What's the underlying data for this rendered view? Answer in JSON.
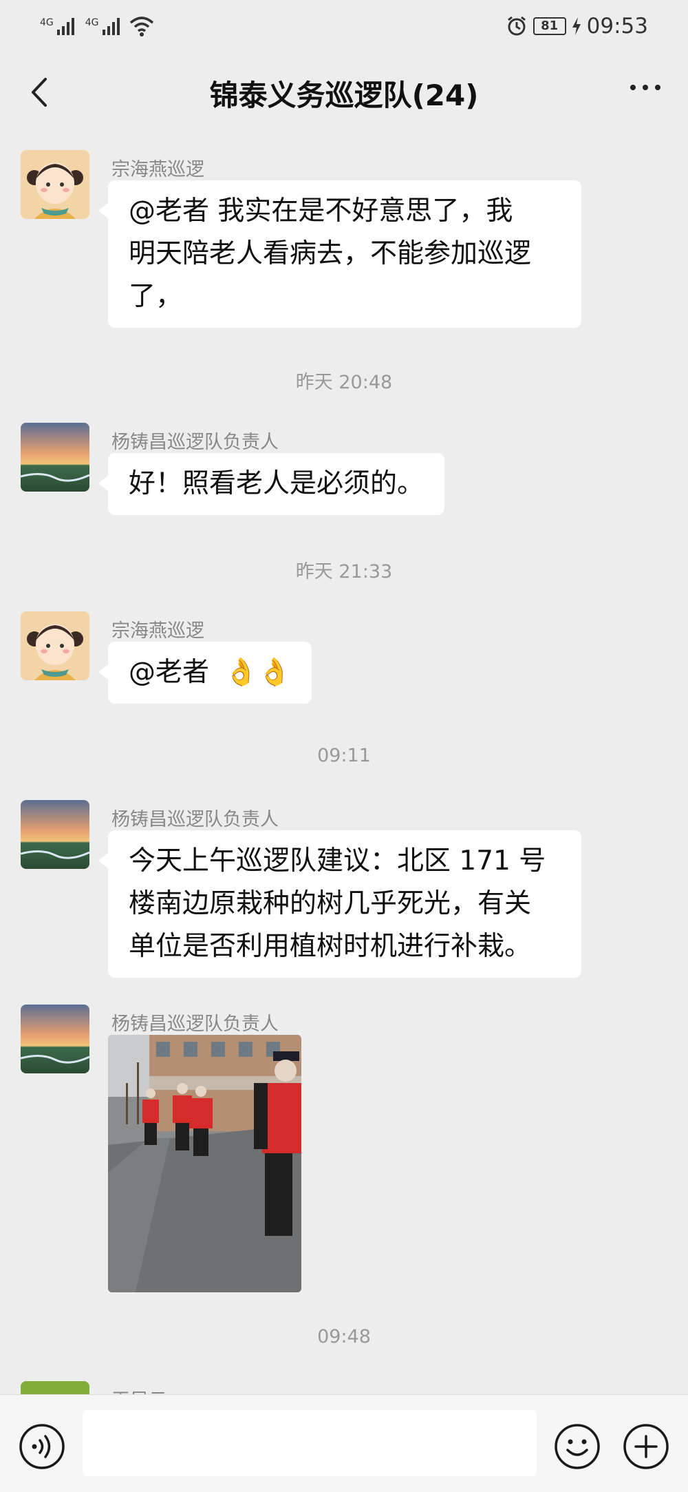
{
  "status_bar": {
    "signal1": "4G",
    "signal2": "4G",
    "battery": "81",
    "time": "09:53"
  },
  "header": {
    "title": "锦泰义务巡逻队(24)"
  },
  "messages": [
    {
      "sender": "宗海燕巡逻",
      "text_lines": [
        "@老者  我实在是不好意思了，我",
        "明天陪老人看病去，不能参加巡逻",
        "了，"
      ]
    },
    {
      "time": "昨天 20:48"
    },
    {
      "sender": "杨铸昌巡逻队负责人",
      "text": "好！照看老人是必须的。"
    },
    {
      "time": "昨天 21:33"
    },
    {
      "sender": "宗海燕巡逻",
      "text": "@老者",
      "emoji": "👌👌"
    },
    {
      "time": "09:11"
    },
    {
      "sender": "杨铸昌巡逻队负责人",
      "text_lines": [
        "今天上午巡逻队建议：北区 171 号",
        "楼南边原栽种的树几乎死光，有关",
        "单位是否利用植树时机进行补栽。"
      ]
    },
    {
      "sender": "杨铸昌巡逻队负责人",
      "image": "patrol-photo"
    },
    {
      "time": "09:48"
    },
    {
      "sender": "王凤云"
    }
  ],
  "input": {
    "placeholder": ""
  },
  "colors": {
    "background": "#ededed",
    "bubble": "#ffffff",
    "vest_red": "#d62b2b"
  },
  "icons": {
    "back": "chevron-left-icon",
    "more": "ellipsis-icon",
    "voice": "voice-icon",
    "emoji": "smiley-icon",
    "plus": "plus-icon"
  }
}
